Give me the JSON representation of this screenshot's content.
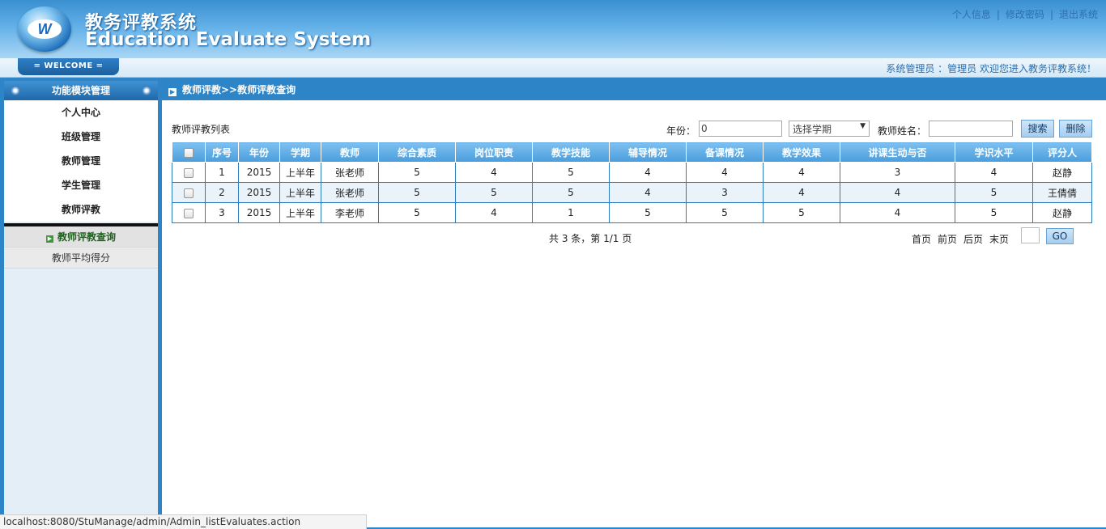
{
  "header": {
    "logo_letter": "W",
    "title_cn": "教务评教系统",
    "title_en": "Education Evaluate System",
    "links": [
      "个人信息",
      "修改密码",
      "退出系统"
    ],
    "link_separator": "|"
  },
  "subbar": {
    "welcome": "= WELCOME =",
    "user_info": "系统管理员 ：管理员   欢迎您进入教务评教系统！"
  },
  "sidebar": {
    "title": "功能模块管理",
    "items": [
      "个人中心",
      "班级管理",
      "教师管理",
      "学生管理",
      "教师评教"
    ],
    "subitems": [
      {
        "label": "教师评教查询",
        "active": true
      },
      {
        "label": "教师平均得分",
        "active": false
      }
    ]
  },
  "breadcrumb": "教师评教>>教师评教查询",
  "list": {
    "title": "教师评教列表",
    "year_label": "年份：",
    "year_value": "0",
    "semester_placeholder": "选择学期",
    "teacher_label": "教师姓名：",
    "teacher_value": "",
    "search_label": "搜索",
    "delete_label": "删除"
  },
  "table": {
    "columns": [
      "序号",
      "年份",
      "学期",
      "教师",
      "综合素质",
      "岗位职责",
      "教学技能",
      "辅导情况",
      "备课情况",
      "教学效果",
      "讲课生动与否",
      "学识水平",
      "评分人"
    ],
    "rows": [
      [
        "1",
        "2015",
        "上半年",
        "张老师",
        "5",
        "4",
        "5",
        "4",
        "4",
        "4",
        "3",
        "4",
        "赵静"
      ],
      [
        "2",
        "2015",
        "上半年",
        "张老师",
        "5",
        "5",
        "5",
        "4",
        "3",
        "4",
        "4",
        "5",
        "王倩倩"
      ],
      [
        "3",
        "2015",
        "上半年",
        "李老师",
        "5",
        "4",
        "1",
        "5",
        "5",
        "5",
        "4",
        "5",
        "赵静"
      ]
    ]
  },
  "pager": {
    "info": "共 3 条，第 1/1 页",
    "first": "首页",
    "prev": "前页",
    "next": "后页",
    "last": "末页",
    "go": "GO"
  },
  "status_url": "localhost:8080/StuManage/admin/Admin_listEvaluates.action"
}
